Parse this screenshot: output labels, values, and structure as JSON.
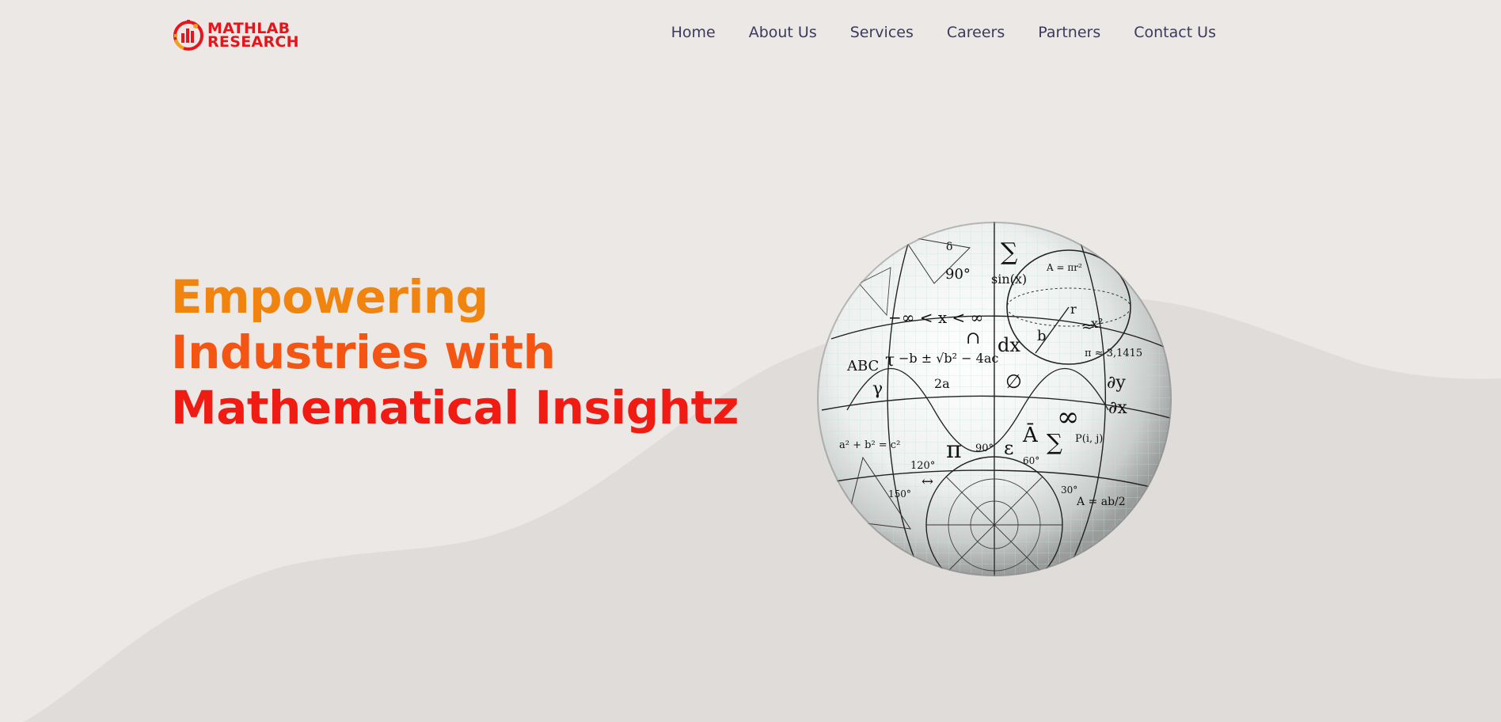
{
  "brand": {
    "line1": "MATHLAB",
    "line2": "RESEARCH",
    "color": "#e8141b",
    "accent": "#f0a01a"
  },
  "nav": {
    "items": [
      {
        "label": "Home"
      },
      {
        "label": "About Us"
      },
      {
        "label": "Services"
      },
      {
        "label": "Careers"
      },
      {
        "label": "Partners"
      },
      {
        "label": "Contact Us"
      }
    ]
  },
  "hero": {
    "line1": "Empowering",
    "line2": "Industries with",
    "line3": "Mathematical Insightz",
    "colors": [
      "#f0840f",
      "#f45512",
      "#f01b13"
    ]
  },
  "globe": {
    "symbols": [
      "∑",
      "π",
      "∞",
      "dx",
      "∩",
      "γ",
      "τ",
      "ε",
      "∅",
      "90°",
      "sin(x)",
      "∂y/∂x",
      "A = πr²",
      "x²",
      "π ≈ 3,1415",
      "−∞ < x < ∞",
      "ABC",
      "Ā",
      "≈",
      "δ",
      "b",
      "r",
      "120°",
      "150°",
      "60°",
      "30°",
      "↔"
    ]
  }
}
